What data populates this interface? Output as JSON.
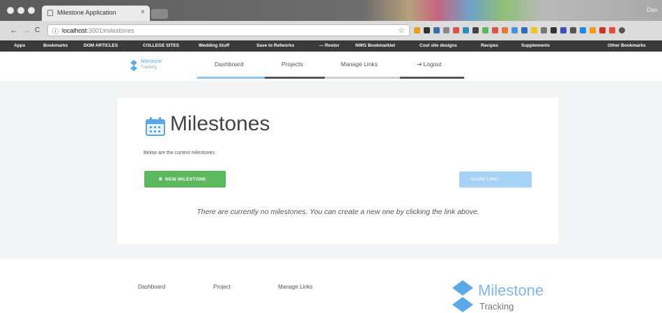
{
  "browser": {
    "tab_title": "Milestone Application",
    "tab_close": "×",
    "window_user": "Dav",
    "address_host": "localhost",
    "address_path": ":3001/milestones",
    "nav_back": "←",
    "nav_forward": "→",
    "nav_reload": "C",
    "bookmarks": [
      "Apps",
      "Bookmarks",
      "DOM ARTICLES",
      "COLLEGE SITES",
      "Wedding Stuff",
      "Save to Refworks",
      "— Restor",
      "NWG Bookmarklet",
      "Cool site designs",
      "Recipes",
      "Supplements",
      "Other Bookmarks"
    ]
  },
  "header": {
    "logo_line1": "Milestone",
    "logo_line2": "Tracking",
    "nav": [
      "Dashboard",
      "Projects",
      "Manage Links",
      "Logout"
    ],
    "logout_icon": "logout-icon"
  },
  "main": {
    "title": "Milestones",
    "title_icon": "calendar-icon",
    "description": "Below are the current milestones",
    "new_button": "NEW MILESTONE",
    "share_button": "SHARE CARD",
    "empty_message": "There are currently no milestones. You can create a new one by clicking the link above."
  },
  "footer": {
    "links": [
      "Dashboard",
      "Project",
      "Manage Links"
    ],
    "logo_line1": "Milestone",
    "logo_line2": "Tracking"
  },
  "colors": {
    "accent": "#5aa9e6",
    "success": "#5cb85c",
    "share": "#a6d2f7",
    "underline_active": "#8cc4ef",
    "underline_dark": "#555555"
  }
}
